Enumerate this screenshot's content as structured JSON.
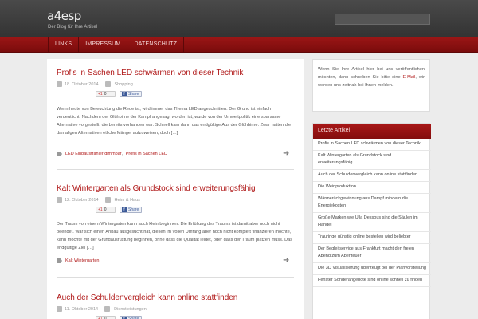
{
  "site": {
    "title": "a4esp",
    "description": "Der Blog für Ihre Artikel"
  },
  "nav": {
    "items": [
      "LINKS",
      "IMPRESSUM",
      "DATENSCHUTZ"
    ]
  },
  "share": {
    "gplus_label": "+1",
    "gplus_count": "0",
    "fb_label": "Share"
  },
  "posts": [
    {
      "title": "Profis in Sachen LED schwärmen von dieser Technik",
      "date": "18. Oktober 2014",
      "category": "Shopping",
      "excerpt": "Wenn heute von Beleuchtung die Rede ist, wird immer das Thema LED angeschnitten. Der Grund ist einfach verdeutlicht. Nachdem der Glühbirne der Kampf angesagt worden ist, wurde von der Umweltpolitik eine sparsame Alternative vorgestellt, die bereits vorhanden war. Schnell kam dann das endgültige Aus der Glühbirne. Zwar hatten die damaligen Alternativen etliche Mängel aufzuweisen, doch […]",
      "tags": [
        "LED Einbaustrahler dimmbar",
        "Profis in Sachen LED"
      ]
    },
    {
      "title": "Kalt Wintergarten als Grundstock sind erweiterungsfähig",
      "date": "12. Oktober 2014",
      "category": "Heim & Haus",
      "excerpt": "Der Traum von einem Wintergarten kann auch klein beginnen. Die Erfüllung des Traums ist damit aber noch nicht beendet. War sich einen Anbau ausgesucht hat, diesen im vollen Umfang aber noch nicht komplett finanzieren möchte, kann möchte mit der Grundausrüstung beginnen, ohne dass die Qualität leidet, oder dass der Traum platzen muss. Das endgültige Ziel […]",
      "tags": [
        "Kalt Wintergarten"
      ]
    },
    {
      "title": "Auch der Schuldenvergleich kann online stattfinden",
      "date": "11. Oktober 2014",
      "category": "Dienstleistungen"
    }
  ],
  "sidebar": {
    "notice_before": "Wenn Sie Ihre Artikel hier bei uns veröffentlichen möchten, dann schreiben Sie bitte eine",
    "notice_link": "E-Mail",
    "notice_after": ", wir werden uns zeitnah bei Ihnen melden.",
    "recent_title": "Letzte Artikel",
    "recent_items": [
      "Profis in Sachen LED schwärmen von dieser Technik",
      "Kalt Wintergarten als Grundstock sind erweiterungsfähig",
      "Auch der Schuldenvergleich kann online stattfinden",
      "Die Weinproduktion",
      "Wärmerückgewinnung aus Dampf mindern die Energiekosten",
      "Große Marken wie Ulla Dessous sind die Säulen im Handel",
      "Trauringe günstig online bestellen wird beliebter",
      "Der Begleitservice aus Frankfurt macht den freien Abend zum Abenteuer",
      "Die 3D Visualisierung überzeugt bei der Planvorstellung",
      "Fenster Sonderangebote sind online schnell zu finden"
    ]
  },
  "colors": {
    "accent": "#b01818",
    "nav_bg": "#8a1010",
    "header_bg": "#3a3a3a"
  }
}
